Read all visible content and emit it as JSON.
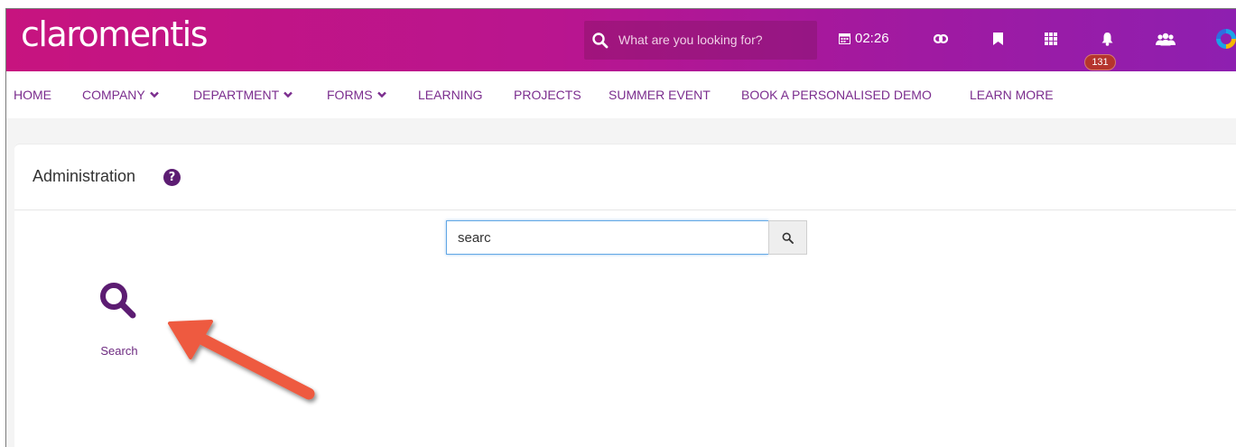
{
  "header": {
    "logo": "claromentis",
    "search_placeholder": "What are you looking for?",
    "clock": "02:26",
    "notification_count": "131",
    "icons": [
      "search-icon",
      "calendar-icon",
      "link-icon",
      "bookmark-icon",
      "apps-grid-icon",
      "bell-icon",
      "people-icon",
      "chrome-icon"
    ]
  },
  "nav": {
    "items": [
      {
        "label": "HOME"
      },
      {
        "label": "COMPANY"
      },
      {
        "label": "DEPARTMENT"
      },
      {
        "label": "FORMS"
      },
      {
        "label": "LEARNING"
      },
      {
        "label": "PROJECTS"
      },
      {
        "label": "SUMMER EVENT"
      },
      {
        "label": "BOOK A PERSONALISED DEMO"
      },
      {
        "label": "LEARN MORE"
      }
    ]
  },
  "panel": {
    "title": "Administration",
    "help_glyph": "?",
    "search_value": "searc",
    "tile": {
      "label": "Search",
      "icon": "search-icon"
    }
  },
  "colors": {
    "topbar_start": "#c7147f",
    "topbar_end": "#8e1fb0",
    "nav_text": "#7b2d8e",
    "accent": "#5c1c72",
    "badge": "#b5342d",
    "annotation_arrow": "#ee5a3f"
  }
}
